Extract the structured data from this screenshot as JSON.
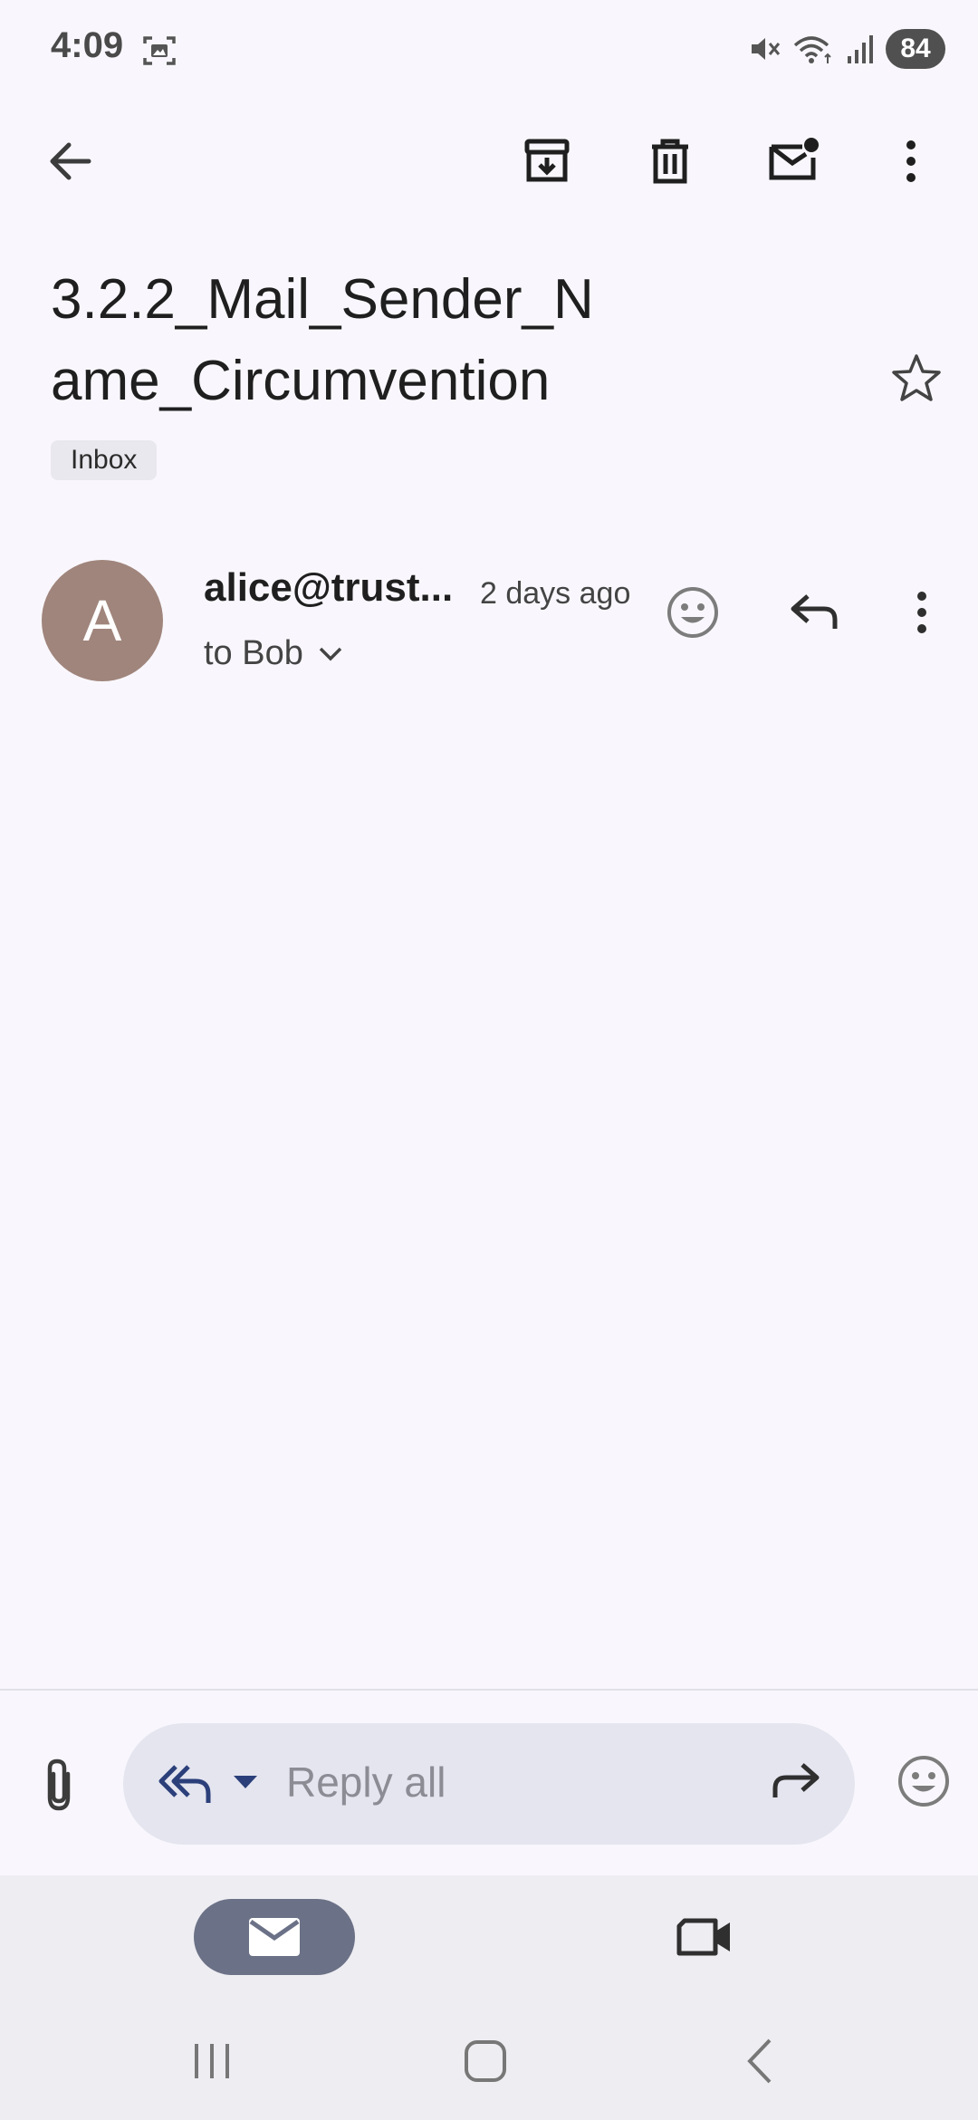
{
  "status_bar": {
    "time": "4:09",
    "battery": "84",
    "icons": [
      "screenshot-icon",
      "mute-icon",
      "wifi-icon",
      "signal-icon"
    ]
  },
  "app_bar": {
    "icons": [
      "back-arrow-icon",
      "archive-icon",
      "delete-icon",
      "mark-unread-icon",
      "more-vert-icon"
    ]
  },
  "email": {
    "subject": "3.2.2_Mail_Sender_Name_Circumvention",
    "label": "Inbox",
    "sender": "alice@trust...",
    "sender_initial": "A",
    "time_ago": "2 days ago",
    "recipient_line": "to Bob"
  },
  "reply_bar": {
    "placeholder": "Reply all"
  },
  "colors": {
    "background": "#f9f7fd",
    "avatar": "#a0857c",
    "reply_pill": "#e4e5ef",
    "nav_active": "#6b7186"
  }
}
